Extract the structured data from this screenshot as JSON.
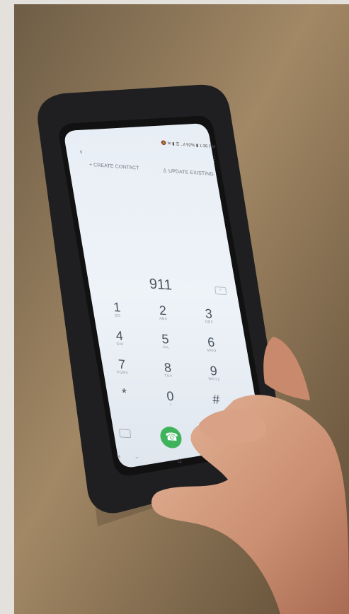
{
  "status_bar": {
    "text": "🔕 ✉ ▮ ☰ ..ıl 92% ▮ 1:36 PM"
  },
  "header": {
    "create_contact": "+ CREATE CONTACT",
    "update_existing": "♙ UPDATE EXISTING"
  },
  "dialer": {
    "number": "911"
  },
  "keypad": [
    {
      "digit": "1",
      "letters": "QO"
    },
    {
      "digit": "2",
      "letters": "ABC"
    },
    {
      "digit": "3",
      "letters": "DEF"
    },
    {
      "digit": "4",
      "letters": "GHI"
    },
    {
      "digit": "5",
      "letters": "JKL"
    },
    {
      "digit": "6",
      "letters": "MNO"
    },
    {
      "digit": "7",
      "letters": "PQRS"
    },
    {
      "digit": "8",
      "letters": "TUV"
    },
    {
      "digit": "9",
      "letters": "WXYZ"
    },
    {
      "digit": "*",
      "letters": ""
    },
    {
      "digit": "0",
      "letters": "+"
    },
    {
      "digit": "#",
      "letters": ""
    }
  ],
  "icons": {
    "back": "back-icon",
    "more": "more-icon",
    "backspace": "backspace-icon",
    "video_call": "video-call-icon",
    "call": "call-icon",
    "nav_back": "nav-back-icon",
    "nav_recent": "nav-recent-icon",
    "nav_home": "nav-home-icon"
  },
  "colors": {
    "wall": "#8c7455",
    "phone_case": "#1f1f21",
    "screen": "#eef3f8",
    "call_button": "#3fb35c",
    "skin": "#d19a7d"
  }
}
